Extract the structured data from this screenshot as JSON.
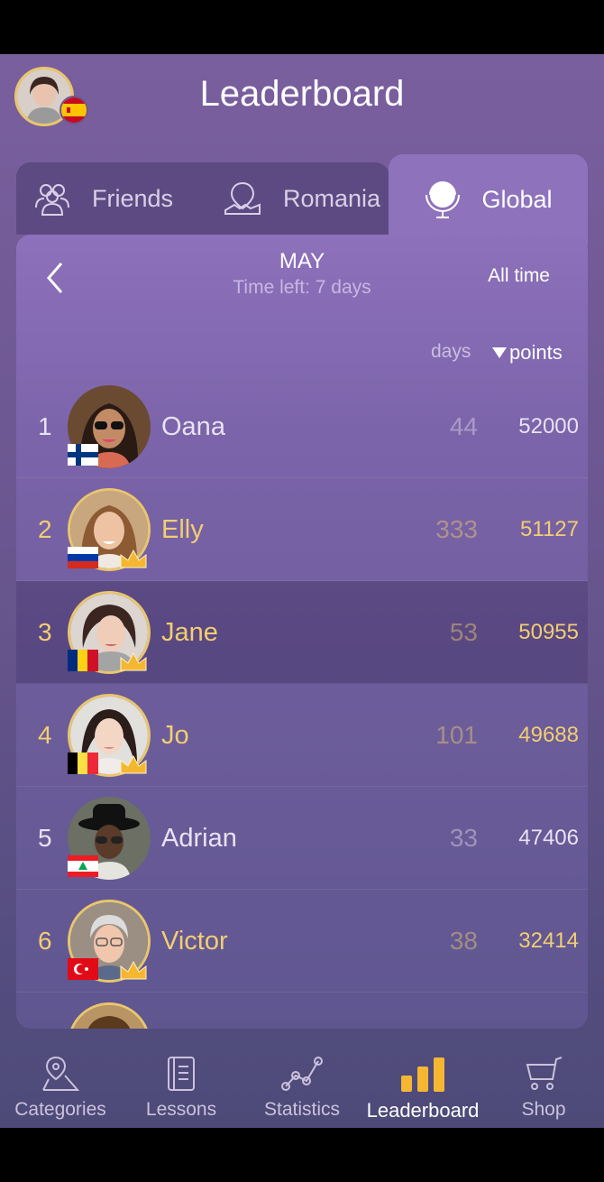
{
  "header": {
    "title": "Leaderboard",
    "user_avatar_icon": "user-avatar",
    "user_flag_icon": "spain-flag"
  },
  "tabs": [
    {
      "label": "Friends",
      "icon": "friends-icon"
    },
    {
      "label": "Romania",
      "icon": "map-pin-icon"
    },
    {
      "label": "Global",
      "icon": "globe-icon",
      "active": true
    }
  ],
  "period": {
    "month": "MAY",
    "time_left": "Time left: 7 days",
    "all_time_label": "All time"
  },
  "columns": {
    "days": "days",
    "points": "points"
  },
  "entries": [
    {
      "rank": "1",
      "name": "Oana",
      "days": "44",
      "points": "52000",
      "flag": "finland",
      "crown": false
    },
    {
      "rank": "2",
      "name": "Elly",
      "days": "333",
      "points": "51127",
      "flag": "russia",
      "crown": true
    },
    {
      "rank": "3",
      "name": "Jane",
      "days": "53",
      "points": "50955",
      "flag": "romania",
      "crown": true,
      "highlighted": true
    },
    {
      "rank": "4",
      "name": "Jo",
      "days": "101",
      "points": "49688",
      "flag": "belgium",
      "crown": true
    },
    {
      "rank": "5",
      "name": "Adrian",
      "days": "33",
      "points": "47406",
      "flag": "lebanon",
      "crown": false
    },
    {
      "rank": "6",
      "name": "Victor",
      "days": "38",
      "points": "32414",
      "flag": "turkey",
      "crown": true
    }
  ],
  "nav": [
    {
      "label": "Categories",
      "icon": "map-icon"
    },
    {
      "label": "Lessons",
      "icon": "book-icon"
    },
    {
      "label": "Statistics",
      "icon": "chart-line-icon"
    },
    {
      "label": "Leaderboard",
      "icon": "bar-chart-icon",
      "active": true
    },
    {
      "label": "Shop",
      "icon": "cart-icon"
    }
  ],
  "colors": {
    "accent_gold": "#f2ce72",
    "active_tab": "#8e73bc",
    "nav_active": "#f5b731"
  }
}
